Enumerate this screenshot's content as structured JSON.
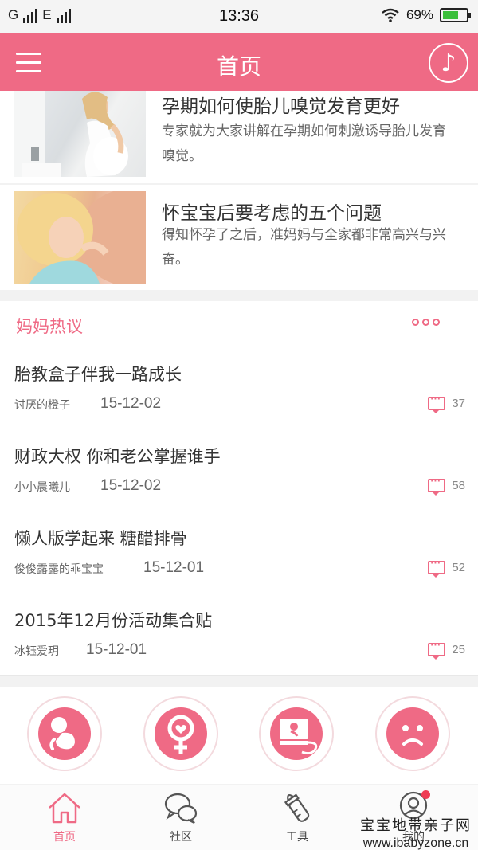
{
  "status_bar": {
    "carrier_1": "G",
    "carrier_2": "E",
    "time": "13:36",
    "battery_percent": "69%",
    "battery_level": 0.69
  },
  "header": {
    "title": "首页",
    "menu_icon": "menu-icon",
    "music_icon": "music-note-icon",
    "music_glyph": "♪"
  },
  "articles": [
    {
      "title": "孕期如何使胎儿嗅觉发育更好",
      "description": "专家就为大家讲解在孕期如何刺激诱导胎儿发育嗅觉。"
    },
    {
      "title": "怀宝宝后要考虑的五个问题",
      "description": "得知怀孕了之后，准妈妈与全家都非常高兴与兴奋。"
    }
  ],
  "discussion": {
    "title": "妈妈热议",
    "topics": [
      {
        "title": "胎教盒子伴我一路成长",
        "author": "讨厌的橙子",
        "date": "15-12-02",
        "comments": "37"
      },
      {
        "title": "财政大权 你和老公掌握谁手",
        "author": "小小晨曦儿",
        "date": "15-12-02",
        "comments": "58"
      },
      {
        "title": "懒人版学起来 糖醋排骨",
        "author": "俊俊露露的乖宝宝",
        "date": "15-12-01",
        "comments": "52"
      },
      {
        "title": "2015年12月份活动集合贴",
        "author": "冰钰爱玥",
        "date": "15-12-01",
        "comments": "25"
      }
    ]
  },
  "tools": [
    {
      "icon": "fetus-icon"
    },
    {
      "icon": "female-heart-icon"
    },
    {
      "icon": "ultrasound-monitor-icon"
    },
    {
      "icon": "sad-face-icon"
    }
  ],
  "tabs": [
    {
      "label": "首页",
      "icon": "home-icon",
      "active": true
    },
    {
      "label": "社区",
      "icon": "chat-bubbles-icon"
    },
    {
      "label": "工具",
      "icon": "baby-bottle-icon"
    },
    {
      "label": "我的",
      "icon": "profile-icon"
    }
  ],
  "watermark": {
    "line1": "宝宝地带亲子网",
    "line2": "www.ibabyzone.cn"
  },
  "colors": {
    "accent": "#ef6a85",
    "badge": "#ef3d55"
  }
}
